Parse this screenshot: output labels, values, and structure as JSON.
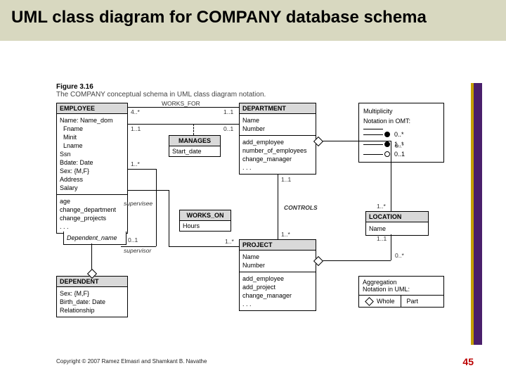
{
  "title": "UML class diagram for COMPANY database schema",
  "figure": {
    "num": "Figure 3.16",
    "caption": "The COMPANY conceptual schema in UML class diagram notation."
  },
  "copyright": "Copyright © 2007 Ramez Elmasri and Shamkant B. Navathe",
  "page": "45",
  "classes": {
    "employee": {
      "name": "EMPLOYEE",
      "attrs": "Name: Name_dom\n  Fname\n  Minit\n  Lname\nSsn\nBdate: Date\nSex: {M,F}\nAddress\nSalary",
      "ops": "age\nchange_department\nchange_projects\n. . .",
      "qual": "Dependent_name"
    },
    "department": {
      "name": "DEPARTMENT",
      "attrs": "Name\nNumber",
      "ops": "add_employee\nnumber_of_employees\nchange_manager\n. . ."
    },
    "project": {
      "name": "PROJECT",
      "attrs": "Name\nNumber",
      "ops": "add_employee\nadd_project\nchange_manager\n. . ."
    },
    "location": {
      "name": "LOCATION",
      "attrs": "Name"
    },
    "dependent": {
      "name": "DEPENDENT",
      "attrs": "Sex: {M,F}\nBirth_date: Date\nRelationship"
    }
  },
  "assoc": {
    "manages": {
      "name": "MANAGES",
      "attr": "Start_date"
    },
    "works_on": {
      "name": "WORKS_ON",
      "attr": "Hours"
    }
  },
  "labels": {
    "works_for": "WORKS_FOR",
    "controls": "CONTROLS",
    "supervisee": "supervisee",
    "supervisor": "supervisor",
    "m4s": "4..*",
    "m11": "1..1",
    "m01": "0..1",
    "m1s": "1..*",
    "m0s": "0..*",
    "m11b": "1..1",
    "m1sb": "1..*",
    "m01b": "0..1",
    "m11c": "1..1",
    "m1sc": "1..*",
    "m11d": "1..1",
    "m0sb": "0..*",
    "m1sd": "1..*"
  },
  "legend": {
    "title": "Multiplicity\nNotation in OMT:",
    "r1": "",
    "r2": "0..*",
    "r3": "1..*",
    "r4": "0..1"
  },
  "agg": {
    "title": "Aggregation\nNotation in UML:",
    "whole": "Whole",
    "part": "Part"
  }
}
